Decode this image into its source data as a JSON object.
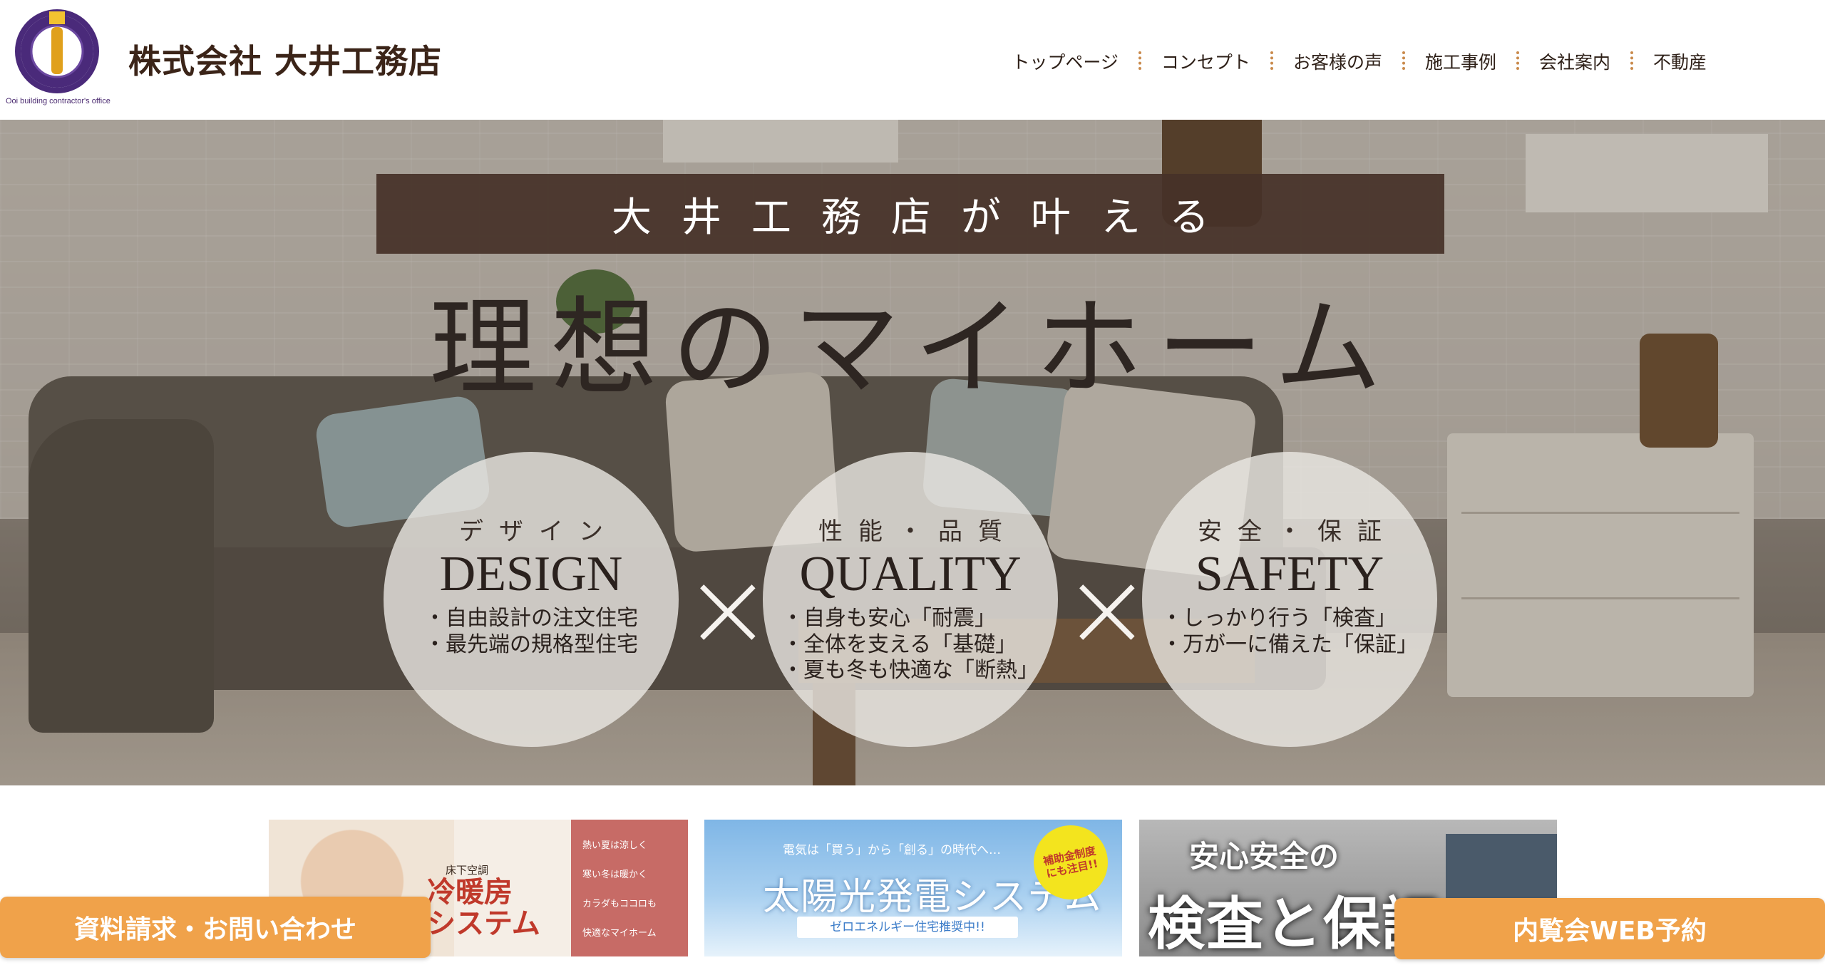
{
  "header": {
    "company_name": "株式会社 大井工務店",
    "logo_subtitle": "Ooi building contractor's office",
    "logo_colors": {
      "ring": "#4a2a7a",
      "inner": "#e0a01c"
    },
    "nav": [
      {
        "label": "トップページ"
      },
      {
        "label": "コンセプト"
      },
      {
        "label": "お客様の声"
      },
      {
        "label": "施工事例"
      },
      {
        "label": "会社案内"
      },
      {
        "label": "不動産"
      }
    ]
  },
  "hero": {
    "banner": "大井工務店が叶える",
    "headline": "理想のマイホーム",
    "separator": "×",
    "circles": [
      {
        "kana": "デザイン",
        "english": "DESIGN",
        "points": [
          "・自由設計の注文住宅",
          "・最先端の規格型住宅"
        ]
      },
      {
        "kana": "性能・品質",
        "english": "QUALITY",
        "points": [
          "・自身も安心「耐震」",
          "・全体を支える「基礎」",
          "・夏も冬も快適な「断熱」"
        ]
      },
      {
        "kana": "安全・保証",
        "english": "SAFETY",
        "points": [
          "・しっかり行う「検査」",
          "・万が一に備えた「保証」"
        ]
      }
    ]
  },
  "promos": {
    "heating": {
      "sub": "床下空調",
      "main_line1": "冷暖房",
      "main_line2": "システム",
      "side": [
        "熱い夏は涼しく",
        "寒い冬は暖かく",
        "カラダもココロも",
        "快適なマイホーム"
      ]
    },
    "solar": {
      "top": "電気は「買う」から「創る」の時代へ…",
      "main": "太陽光発電システム",
      "bar": "ゼロエネルギー住宅推奨中!!",
      "badge_line1": "補助金制度",
      "badge_line2": "にも注目!!"
    },
    "inspection": {
      "line1": "安心安全の",
      "line2": "検査と保証"
    }
  },
  "cta": {
    "left": "資料請求・お問い合わせ",
    "right": "内覧会WEB予約",
    "color": "#f0a24a"
  }
}
